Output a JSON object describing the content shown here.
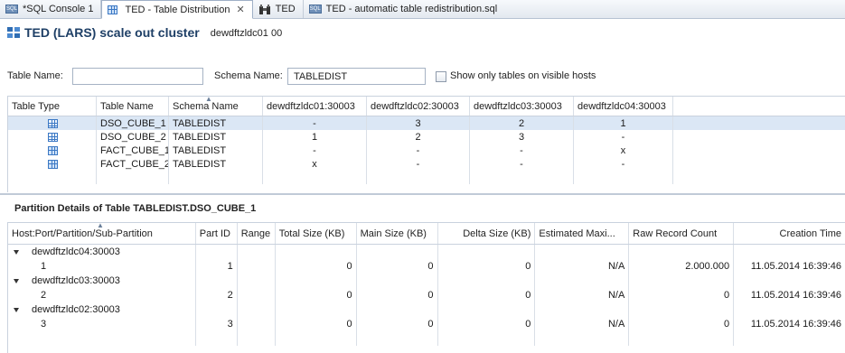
{
  "tabs": [
    {
      "label": "*SQL Console 1",
      "icon": "sql-console-icon",
      "active": false
    },
    {
      "label": "TED - Table Distribution",
      "icon": "table-icon",
      "active": true
    },
    {
      "label": "TED",
      "icon": "binoculars-icon",
      "active": false
    },
    {
      "label": "TED - automatic table redistribution.sql",
      "icon": "sql-file-icon",
      "active": false
    }
  ],
  "tab_close_glyph": "✕",
  "header": {
    "title": "TED (LARS) scale out cluster",
    "host": "dewdftzldc01 00"
  },
  "filters": {
    "table_name_label": "Table Name:",
    "table_name_value": "",
    "schema_name_label": "Schema Name:",
    "schema_name_value": "TABLEDIST",
    "show_visible_hosts_label": "Show only tables on visible hosts",
    "show_visible_hosts_checked": false
  },
  "distribution_table": {
    "columns": [
      "Table Type",
      "Table Name",
      "Schema Name",
      "dewdftzldc01:30003",
      "dewdftzldc02:30003",
      "dewdftzldc03:30003",
      "dewdftzldc04:30003"
    ],
    "rows": [
      {
        "type_icon": "column-table-icon",
        "name": "DSO_CUBE_1",
        "schema": "TABLEDIST",
        "h1": "-",
        "h2": "3",
        "h3": "2",
        "h4": "1"
      },
      {
        "type_icon": "column-table-icon",
        "name": "DSO_CUBE_2",
        "schema": "TABLEDIST",
        "h1": "1",
        "h2": "2",
        "h3": "3",
        "h4": "-"
      },
      {
        "type_icon": "row-table-icon",
        "name": "FACT_CUBE_1",
        "schema": "TABLEDIST",
        "h1": "-",
        "h2": "-",
        "h3": "-",
        "h4": "x"
      },
      {
        "type_icon": "row-table-icon",
        "name": "FACT_CUBE_2",
        "schema": "TABLEDIST",
        "h1": "x",
        "h2": "-",
        "h3": "-",
        "h4": "-"
      }
    ]
  },
  "partition_details": {
    "title": "Partition Details of Table TABLEDIST.DSO_CUBE_1",
    "columns": [
      "Host:Port/Partition/Sub-Partition",
      "Part ID",
      "Range",
      "Total Size (KB)",
      "Main Size (KB)",
      "Delta Size (KB)",
      "Estimated Maxi...",
      "Raw Record Count",
      "Creation Time"
    ],
    "groups": [
      {
        "host": "dewdftzldc04:30003",
        "partition": "1",
        "part_id": "1",
        "range": "",
        "total": "0",
        "main": "0",
        "delta": "0",
        "est": "N/A",
        "raw": "2.000.000",
        "created": "11.05.2014 16:39:46"
      },
      {
        "host": "dewdftzldc03:30003",
        "partition": "2",
        "part_id": "2",
        "range": "",
        "total": "0",
        "main": "0",
        "delta": "0",
        "est": "N/A",
        "raw": "0",
        "created": "11.05.2014 16:39:46"
      },
      {
        "host": "dewdftzldc02:30003",
        "partition": "3",
        "part_id": "3",
        "range": "",
        "total": "0",
        "main": "0",
        "delta": "0",
        "est": "N/A",
        "raw": "0",
        "created": "11.05.2014 16:39:46"
      }
    ]
  },
  "colors": {
    "title_blue": "#1e3f66",
    "selection": "#dbe7f5",
    "grid_line": "#c9d2de"
  }
}
